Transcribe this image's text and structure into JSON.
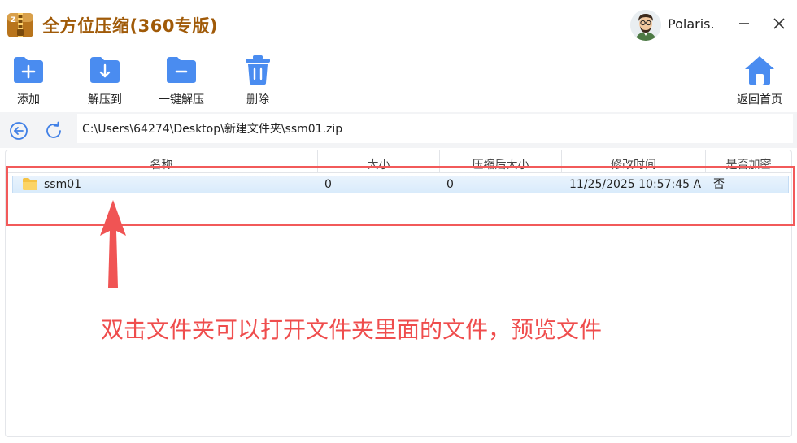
{
  "app": {
    "title": "全方位压缩(360专版)",
    "user_name": "Polaris.",
    "accent_color": "#4a8cf0",
    "brand_color": "#a05a08"
  },
  "window_controls": {
    "minimize_icon": "minimize-icon",
    "close_icon": "close-icon"
  },
  "toolbar": {
    "add_label": "添加",
    "extract_to_label": "解压到",
    "one_click_extract_label": "一键解压",
    "delete_label": "删除",
    "home_label": "返回首页"
  },
  "address": {
    "path": "C:\\Users\\64274\\Desktop\\新建文件夹\\ssm01.zip"
  },
  "file_list": {
    "columns": [
      "名称",
      "大小",
      "压缩后大小",
      "修改时间",
      "是否加密"
    ],
    "rows": [
      {
        "name": "ssm01",
        "size": "0",
        "compressed_size": "0",
        "modified": "11/25/2025 10:57:45 A",
        "encrypted": "否",
        "icon": "folder-icon"
      }
    ]
  },
  "annotation": {
    "text": "双击文件夹可以打开文件夹里面的文件，预览文件",
    "color": "#ef4d4d"
  }
}
